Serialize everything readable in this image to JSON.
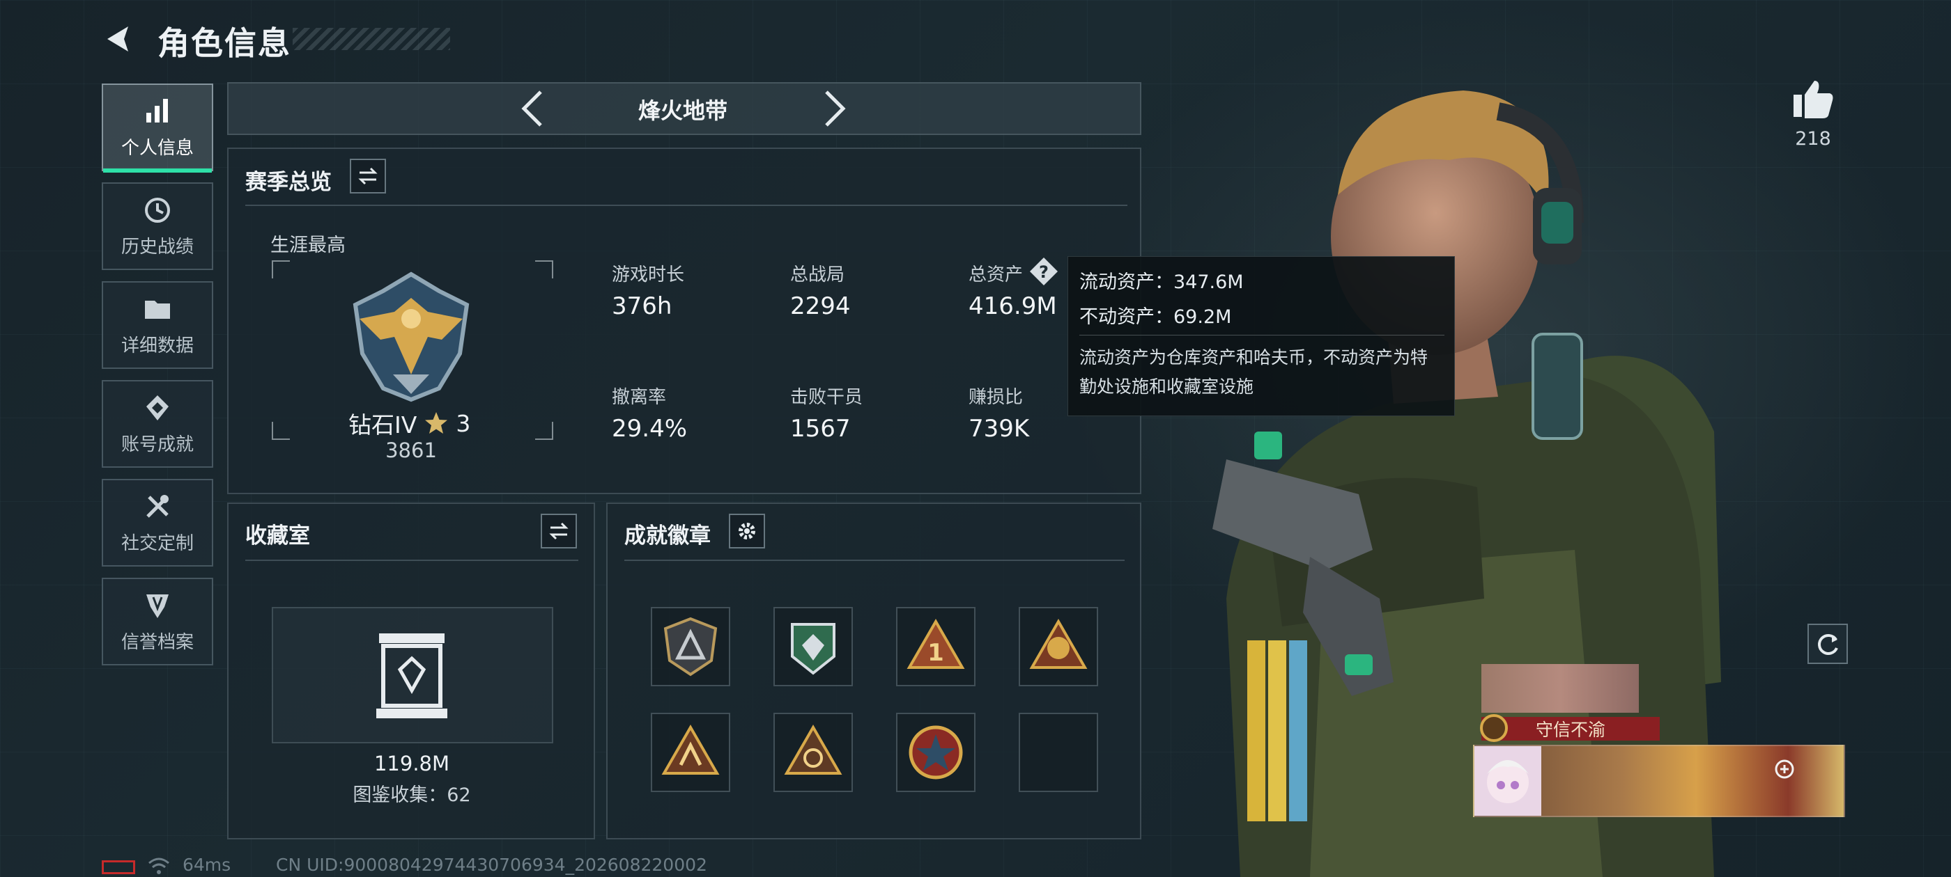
{
  "header": {
    "title": "角色信息"
  },
  "sidebar": {
    "items": [
      {
        "label": "个人信息",
        "icon": "bar-chart-icon",
        "active": true
      },
      {
        "label": "历史战绩",
        "icon": "history-clock-icon",
        "active": false
      },
      {
        "label": "详细数据",
        "icon": "folder-icon",
        "active": false
      },
      {
        "label": "账号成就",
        "icon": "achievement-icon",
        "active": false
      },
      {
        "label": "社交定制",
        "icon": "tools-icon",
        "active": false
      },
      {
        "label": "信誉档案",
        "icon": "shield-icon",
        "active": false
      }
    ]
  },
  "mode": {
    "name": "烽火地带"
  },
  "season": {
    "title": "赛季总览",
    "career_label": "生涯最高",
    "rank": "钻石IV",
    "stars": "3",
    "points": "3861",
    "stats": [
      {
        "label": "游戏时长",
        "value": "376h"
      },
      {
        "label": "总战局",
        "value": "2294"
      },
      {
        "label": "总资产",
        "value": "416.9M"
      },
      {
        "label": "撤离率",
        "value": "29.4%"
      },
      {
        "label": "击败干员",
        "value": "1567"
      },
      {
        "label": "赚损比",
        "value": "739K"
      }
    ]
  },
  "tooltip": {
    "liquid": "流动资产：347.6M",
    "fixed": "不动资产：69.2M",
    "description": "流动资产为仓库资产和哈夫币，不动资产为特勤处设施和收藏室设施"
  },
  "collection": {
    "title": "收藏室",
    "value": "119.8M",
    "gallery": "图鉴收集：62"
  },
  "achievements": {
    "title": "成就徽章"
  },
  "likes": {
    "count": "218"
  },
  "nameplate": {
    "title": "守信不渝"
  },
  "footer": {
    "ping": "64ms",
    "uid": "CN UID:9000804297443070693​4_202608220002"
  },
  "colors": {
    "accent": "#2ee0a8",
    "gold": "#d8a94a",
    "banner": "#8a1f22"
  }
}
